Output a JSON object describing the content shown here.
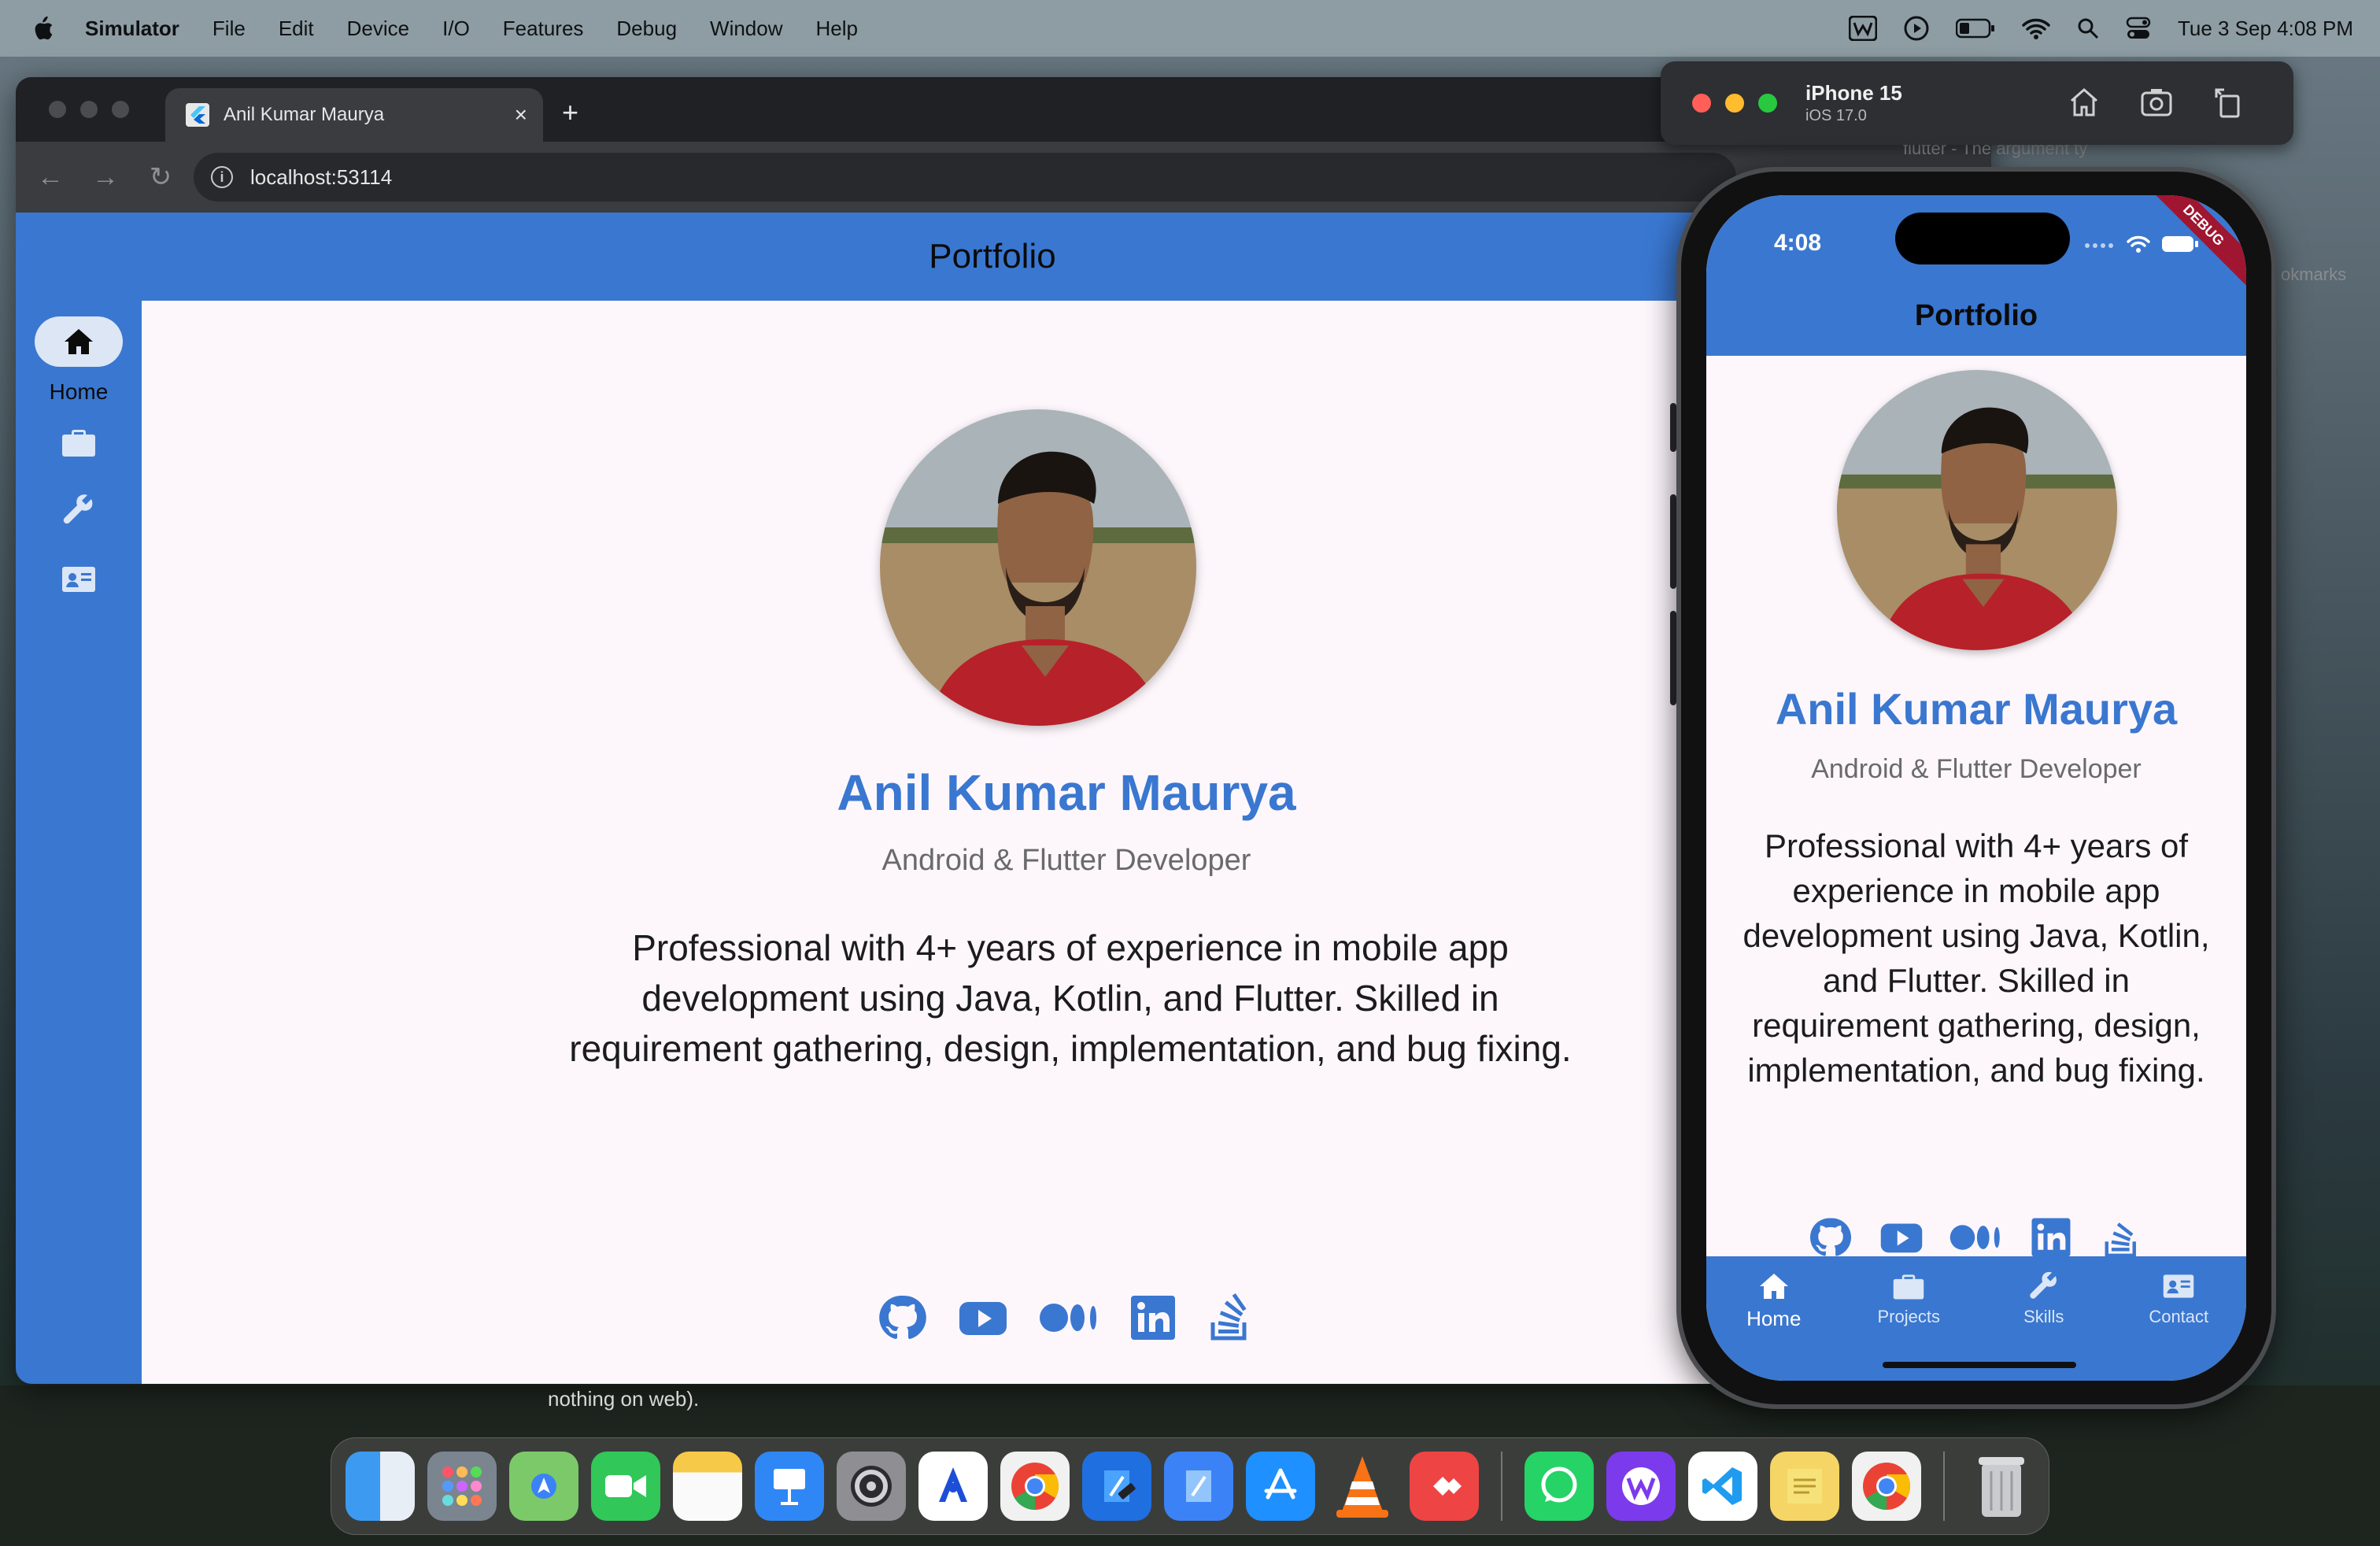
{
  "menubar": {
    "app_name": "Simulator",
    "items": [
      "File",
      "Edit",
      "Device",
      "I/O",
      "Features",
      "Debug",
      "Window",
      "Help"
    ],
    "date_time": "Tue 3 Sep  4:08 PM",
    "status_icons": [
      "w-icon",
      "play-icon",
      "battery-icon",
      "wifi-icon",
      "search-icon",
      "control-center-icon"
    ]
  },
  "browser": {
    "tab_title": "Anil Kumar Maurya",
    "url": "localhost:53114",
    "background_tab_title": "flutter - The argument ty",
    "bookmarks_label": "okmarks"
  },
  "web_app": {
    "appbar_title": "Portfolio",
    "rail": {
      "items": [
        {
          "label": "Home",
          "icon": "home-icon",
          "selected": true
        },
        {
          "label": "",
          "icon": "work-icon",
          "selected": false
        },
        {
          "label": "",
          "icon": "wrench-icon",
          "selected": false
        },
        {
          "label": "",
          "icon": "contact-card-icon",
          "selected": false
        }
      ]
    },
    "profile": {
      "name": "Anil Kumar Maurya",
      "role": "Android & Flutter Developer",
      "bio": "Professional with 4+ years of experience in mobile app development using Java, Kotlin, and Flutter. Skilled in requirement gathering, design, implementation, and bug fixing."
    },
    "social_icons": [
      "github-icon",
      "youtube-icon",
      "medium-icon",
      "linkedin-icon",
      "stackoverflow-icon"
    ]
  },
  "simulator": {
    "device_name": "iPhone 15",
    "os_version": "iOS 17.0",
    "toolbar_icons": [
      "home-icon",
      "screenshot-icon",
      "rotate-icon"
    ]
  },
  "phone": {
    "time": "4:08",
    "debug_banner": "DEBUG",
    "appbar_title": "Portfolio",
    "name": "Anil Kumar Maurya",
    "role": "Android & Flutter Developer",
    "bio": "Professional with 4+ years of experience in mobile app development using Java, Kotlin, and Flutter. Skilled in requirement gathering, design, implementation, and bug fixing.",
    "nav": [
      {
        "label": "Home",
        "icon": "home-icon",
        "active": true
      },
      {
        "label": "Projects",
        "icon": "work-icon",
        "active": false
      },
      {
        "label": "Skills",
        "icon": "wrench-icon",
        "active": false
      },
      {
        "label": "Contact",
        "icon": "contact-card-icon",
        "active": false
      }
    ]
  },
  "background_text": "nothing on web).",
  "dock": {
    "apps": [
      "finder-icon",
      "launchpad-icon",
      "maps-icon",
      "facetime-icon",
      "notes-icon",
      "keynote-icon",
      "system-settings-icon",
      "instruments-icon",
      "chrome-icon",
      "xcode-icon",
      "xcode-beta-icon",
      "app-store-icon",
      "vlc-icon",
      "anydesk-icon",
      "whatsapp-icon",
      "wps-office-icon",
      "vscode-icon",
      "stickies-icon",
      "chrome-icon",
      "trash-icon"
    ]
  },
  "colors": {
    "primary": "#3a77d0",
    "surface": "#fdf7fc",
    "name_text": "#3a77d0",
    "debug_banner": "#a01530"
  }
}
